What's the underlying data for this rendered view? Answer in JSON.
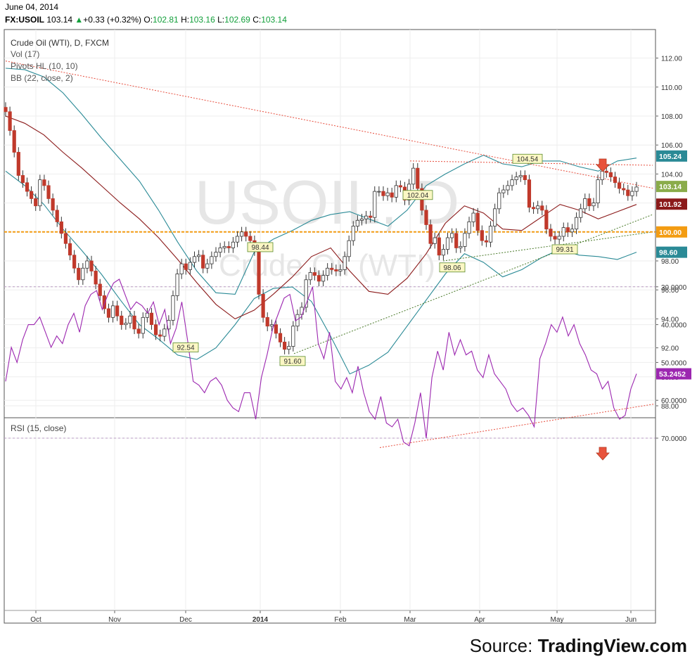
{
  "header": {
    "date": "June 04, 2014",
    "symbol": "FX:USOIL",
    "last": "103.14",
    "change_arrow": "▲",
    "change": "+0.33 (+0.32%)",
    "open_label": "O:",
    "open": "102.81",
    "high_label": "H:",
    "high": "103.16",
    "low_label": "L:",
    "low": "102.69",
    "close_label": "C:",
    "close": "103.14"
  },
  "legend": {
    "title": "Crude Oil (WTI), D, FXCM",
    "vol": "Vol (17)",
    "pivots": "Pivots HL (10, 10)",
    "bb": "BB (22, close, 2)",
    "rsi": "RSI (15, close)"
  },
  "watermark": {
    "symbol": "USOIL, D",
    "name": "Crude Oil (WTI)"
  },
  "source": {
    "prefix": "Source: ",
    "brand": "TradingView.com"
  },
  "colors": {
    "candle": "#c0392b",
    "bb_band": "#2a8a96",
    "bb_basis": "#8b1a1a",
    "trend_red": "#e74c3c",
    "trend_green": "#4a7a2a",
    "level_orange": "#f39c12",
    "rsi_line": "#9c27b0",
    "rsi_fill": "#f3e1f7"
  },
  "chart_data": [
    {
      "type": "candlestick",
      "ylim": [
        86.5,
        114
      ],
      "y_ticks": [
        "112.00",
        "110.00",
        "108.00",
        "106.00",
        "104.00",
        "102.00",
        "100.00",
        "98.00",
        "96.00",
        "94.00",
        "92.00",
        "90.00",
        "88.00"
      ],
      "x_ticks": [
        "Oct",
        "Nov",
        "Dec",
        "2014",
        "Feb",
        "Mar",
        "Apr",
        "May",
        "Jun"
      ],
      "close_series": [
        108.3,
        107.0,
        105.5,
        103.9,
        103.4,
        102.8,
        102.3,
        101.8,
        103.6,
        103.2,
        102.3,
        101.5,
        100.7,
        99.9,
        99.2,
        98.4,
        97.5,
        96.7,
        97.5,
        98.0,
        97.3,
        96.4,
        95.6,
        94.7,
        94.1,
        94.9,
        94.2,
        93.6,
        93.7,
        94.2,
        93.3,
        93.0,
        94.1,
        94.4,
        93.6,
        92.9,
        92.8,
        93.3,
        93.9,
        95.6,
        97.1,
        97.8,
        97.4,
        97.9,
        98.3,
        98.4,
        97.5,
        97.8,
        98.3,
        98.6,
        98.9,
        99.0,
        98.9,
        99.3,
        99.7,
        100.0,
        99.7,
        99.4,
        98.7,
        95.7,
        94.1,
        93.5,
        93.6,
        93.0,
        92.4,
        91.9,
        92.1,
        93.5,
        94.3,
        94.8,
        96.7,
        97.2,
        97.0,
        96.6,
        97.0,
        97.5,
        97.4,
        97.3,
        97.4,
        98.3,
        99.4,
        100.4,
        100.8,
        100.9,
        101.1,
        101.0,
        102.8,
        102.8,
        102.5,
        102.7,
        102.4,
        103.2,
        103.1,
        102.2,
        103.3,
        104.4,
        103.0,
        101.5,
        100.5,
        99.2,
        99.6,
        98.4,
        98.8,
        99.6,
        99.9,
        98.9,
        99.0,
        99.9,
        100.7,
        101.3,
        100.1,
        99.4,
        99.3,
        100.4,
        101.6,
        102.7,
        102.9,
        103.2,
        103.6,
        103.8,
        103.9,
        103.6,
        101.7,
        101.6,
        101.8,
        101.5,
        100.2,
        99.7,
        99.5,
        99.7,
        100.3,
        100.0,
        100.2,
        101.0,
        101.6,
        102.3,
        101.8,
        102.0,
        103.6,
        104.2,
        104.1,
        103.8,
        103.4,
        103.0,
        102.9,
        102.5,
        102.8,
        103.1
      ],
      "bb_upper": [
        111.3,
        111.2,
        110.7,
        109.6,
        108.1,
        106.5,
        105.0,
        103.5,
        101.5,
        99.3,
        97.3,
        95.8,
        95.7,
        98.6,
        99.5,
        100.1,
        100.8,
        101.2,
        101.4,
        100.9,
        100.4,
        101.5,
        103.2,
        104.0,
        104.7,
        105.3,
        104.7,
        104.5,
        104.9,
        104.9,
        104.5,
        104.2,
        104.9,
        105.1
      ],
      "bb_basis": [
        108.0,
        107.5,
        106.7,
        105.5,
        104.4,
        103.2,
        102.0,
        100.9,
        99.6,
        98.1,
        96.5,
        95.0,
        94.0,
        94.6,
        95.7,
        96.9,
        98.3,
        98.9,
        97.3,
        95.9,
        95.7,
        96.8,
        98.5,
        100.6,
        101.8,
        101.3,
        100.2,
        100.1,
        101.0,
        101.9,
        101.5,
        100.9,
        101.4,
        101.9
      ],
      "bb_lower": [
        104.2,
        103.2,
        101.9,
        100.2,
        98.7,
        97.1,
        95.3,
        93.6,
        92.6,
        91.5,
        91.2,
        92.0,
        93.6,
        95.4,
        96.1,
        96.2,
        95.2,
        92.8,
        90.2,
        90.8,
        91.7,
        93.5,
        95.3,
        97.1,
        98.5,
        97.9,
        96.9,
        97.4,
        98.2,
        98.8,
        98.4,
        98.3,
        98.1,
        98.6
      ],
      "price_labels": [
        "105.24",
        "103.14",
        "101.92",
        "100.00",
        "98.60"
      ],
      "pivots": [
        "92.54",
        "98.44",
        "91.60",
        "102.04",
        "98.06",
        "104.54",
        "99.31"
      ]
    },
    {
      "type": "line",
      "name": "RSI (15, close)",
      "ylim": [
        26,
        75
      ],
      "y_ticks": [
        "70.0000",
        "60.0000",
        "50.0000",
        "40.0000",
        "30.0000"
      ],
      "band": [
        30,
        70
      ],
      "values": [
        55,
        46,
        50,
        44,
        40,
        40,
        38,
        42,
        46,
        43,
        45,
        40,
        37,
        42,
        35,
        32,
        31,
        36,
        32,
        29,
        28,
        32,
        36,
        34,
        35,
        37,
        34,
        40,
        36,
        45,
        41,
        34,
        44,
        55,
        56,
        58,
        55,
        54,
        56,
        60,
        62,
        63,
        58,
        58,
        65,
        54,
        48,
        41,
        37,
        33,
        32,
        39,
        38,
        34,
        30,
        45,
        49,
        42,
        55,
        57,
        54,
        58,
        51,
        58,
        63,
        65,
        59,
        66,
        67,
        65,
        71,
        72,
        66,
        58,
        70,
        54,
        47,
        52,
        42,
        48,
        44,
        48,
        47,
        52,
        54,
        48,
        53,
        55,
        57,
        61,
        63,
        62,
        64,
        67,
        49,
        45,
        40,
        42,
        38,
        43,
        40,
        45,
        48,
        52,
        53,
        57,
        55,
        62,
        65,
        64,
        57,
        53
      ]
    }
  ]
}
